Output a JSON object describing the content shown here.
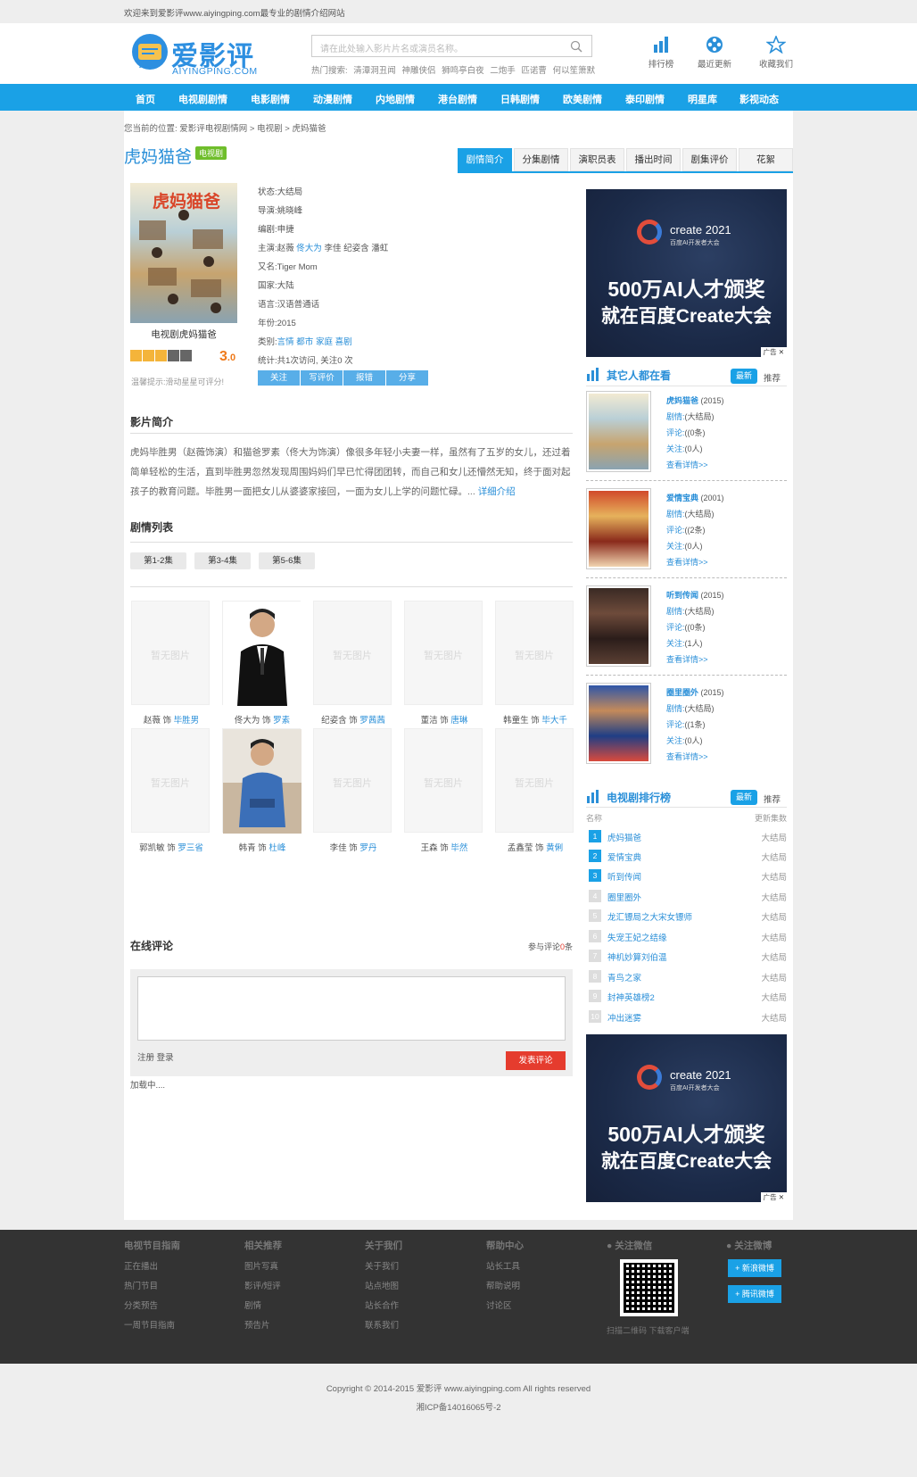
{
  "topbar": {
    "welcome": "欢迎来到爱影评www.aiyingping.com最专业的剧情介绍网站"
  },
  "logo": {
    "name": "爱影评",
    "domain": "AIYINGPING.COM"
  },
  "search": {
    "placeholder": "请在此处输入影片片名或演员名称。",
    "hot_label": "热门搜索:",
    "hot_items": [
      "清潭洞丑闻",
      "神雕侠侣",
      "狮鸣亭白夜",
      "二炮手",
      "匹诺曹",
      "何以笙箫默"
    ]
  },
  "header_links": [
    {
      "label": "排行榜",
      "icon": "chart-icon"
    },
    {
      "label": "最近更新",
      "icon": "film-reel-icon"
    },
    {
      "label": "收藏我们",
      "icon": "star-icon"
    }
  ],
  "nav": [
    "首页",
    "电视剧剧情",
    "电影剧情",
    "动漫剧情",
    "内地剧情",
    "港台剧情",
    "日韩剧情",
    "欧美剧情",
    "泰印剧情",
    "明星库",
    "影视动态"
  ],
  "breadcrumb": {
    "prefix": "您当前的位置:",
    "items": [
      "爱影评电视剧情网",
      "电视剧",
      "虎妈猫爸"
    ]
  },
  "title": "虎妈猫爸",
  "tag": "电视剧",
  "tabs": [
    "剧情简介",
    "分集剧情",
    "演职员表",
    "播出时间",
    "剧集评价",
    "花絮"
  ],
  "poster": {
    "title_on_image": "虎妈猫爸",
    "caption": "电视剧虎妈猫爸"
  },
  "rating": {
    "score_int": "3",
    "score_dec": ".0",
    "stars_on": 3,
    "stars_total": 5,
    "tip": "温馨提示:滑动星星可评分!"
  },
  "info": {
    "status": {
      "label": "状态:",
      "value": "大结局"
    },
    "director": {
      "label": "导演:",
      "value": "姚晓峰"
    },
    "writer": {
      "label": "编剧:",
      "value": "申捷"
    },
    "cast": {
      "label": "主演:",
      "values": [
        "赵薇",
        "佟大为",
        "李佳",
        "纪姿含",
        "潘虹"
      ]
    },
    "alias": {
      "label": "又名:",
      "value": "Tiger Mom"
    },
    "country": {
      "label": "国家:",
      "value": "大陆"
    },
    "language": {
      "label": "语言:",
      "value": "汉语普通话"
    },
    "year": {
      "label": "年份:",
      "value": "2015"
    },
    "genre": {
      "label": "类别:",
      "values": [
        "言情",
        "都市",
        "家庭",
        "喜剧"
      ]
    },
    "stats": {
      "label": "统计:",
      "value": "共1次访问, 关注0 次"
    }
  },
  "actions": [
    "关注",
    "写评价",
    "报错",
    "分享"
  ],
  "intro": {
    "heading": "影片简介",
    "text": "虎妈毕胜男（赵薇饰演）和猫爸罗素（佟大为饰演）像很多年轻小夫妻一样，虽然有了五岁的女儿，还过着简单轻松的生活，直到毕胜男忽然发现周围妈妈们早已忙得团团转，而自己和女儿还懵然无知，终于面对起孩子的教育问题。毕胜男一面把女儿从婆婆家接回，一面为女儿上学的问题忙碌。...",
    "more": "详细介绍"
  },
  "episodes": {
    "heading": "剧情列表",
    "items": [
      "第1-2集",
      "第3-4集",
      "第5-6集"
    ]
  },
  "cast_cards": [
    {
      "actor": "赵薇",
      "sep": "饰",
      "role": "毕胜男",
      "has_photo": false
    },
    {
      "actor": "佟大为",
      "sep": "饰",
      "role": "罗素",
      "has_photo": true
    },
    {
      "actor": "纪姿含",
      "sep": "饰",
      "role": "罗茜茜",
      "has_photo": false
    },
    {
      "actor": "董洁",
      "sep": "饰",
      "role": "唐琳",
      "has_photo": false
    },
    {
      "actor": "韩童生",
      "sep": "饰",
      "role": "毕大千",
      "has_photo": false
    },
    {
      "actor": "郭凯敏",
      "sep": "饰",
      "role": "罗三省",
      "has_photo": false
    },
    {
      "actor": "韩青",
      "sep": "饰",
      "role": "杜峰",
      "has_photo": true
    },
    {
      "actor": "李佳",
      "sep": "饰",
      "role": "罗丹",
      "has_photo": false
    },
    {
      "actor": "王森",
      "sep": "饰",
      "role": "毕然",
      "has_photo": false
    },
    {
      "actor": "孟鑫莹",
      "sep": "饰",
      "role": "黄俐",
      "has_photo": false
    }
  ],
  "no_image_text": "暂无图片",
  "watermark": "aiyingping.com",
  "comments": {
    "heading": "在线评论",
    "count_prefix": "参与评论",
    "count": "0",
    "count_suffix": "条",
    "register": "注册",
    "login": "登录",
    "submit": "发表评论",
    "loading": "加载中...."
  },
  "ad": {
    "brand": "create 2021",
    "sub": "百度AI开发者大会",
    "line1": "500万AI人才颁奖",
    "line2": "就在百度Create大会",
    "tag": "广告"
  },
  "others": {
    "heading": "其它人都在看",
    "tab_new": "最新",
    "tab_rec": "推荐",
    "items": [
      {
        "name": "虎妈猫爸",
        "year": "(2015)",
        "plot": "剧情:",
        "plot_v": "(大结局)",
        "review": "评论:",
        "review_v": "((0条)",
        "follow": "关注:",
        "follow_v": "(0人)",
        "more": "查看详情>>"
      },
      {
        "name": "爱情宝典",
        "year": "(2001)",
        "plot": "剧情:",
        "plot_v": "(大结局)",
        "review": "评论:",
        "review_v": "((2条)",
        "follow": "关注:",
        "follow_v": "(0人)",
        "more": "查看详情>>"
      },
      {
        "name": "听到传闻",
        "year": "(2015)",
        "plot": "剧情:",
        "plot_v": "(大结局)",
        "review": "评论:",
        "review_v": "((0条)",
        "follow": "关注:",
        "follow_v": "(1人)",
        "more": "查看详情>>"
      },
      {
        "name": "圈里圈外",
        "year": "(2015)",
        "plot": "剧情:",
        "plot_v": "(大结局)",
        "review": "评论:",
        "review_v": "((1条)",
        "follow": "关注:",
        "follow_v": "(0人)",
        "more": "查看详情>>"
      }
    ]
  },
  "ranking": {
    "heading": "电视剧排行榜",
    "tab_new": "最新",
    "tab_rec": "推荐",
    "col_name": "名称",
    "col_update": "更新集数",
    "items": [
      {
        "n": "1",
        "name": "虎妈猫爸",
        "status": "大结局"
      },
      {
        "n": "2",
        "name": "爱情宝典",
        "status": "大结局"
      },
      {
        "n": "3",
        "name": "听到传闻",
        "status": "大结局"
      },
      {
        "n": "4",
        "name": "圈里圈外",
        "status": "大结局"
      },
      {
        "n": "5",
        "name": "龙汇镖局之大宋女镖师",
        "status": "大结局"
      },
      {
        "n": "6",
        "name": "失宠王妃之结缘",
        "status": "大结局"
      },
      {
        "n": "7",
        "name": "神机妙算刘伯温",
        "status": "大结局"
      },
      {
        "n": "8",
        "name": "青鸟之家",
        "status": "大结局"
      },
      {
        "n": "9",
        "name": "封神英雄榜2",
        "status": "大结局"
      },
      {
        "n": "10",
        "name": "冲出迷雾",
        "status": "大结局"
      }
    ]
  },
  "footer": {
    "cols": [
      {
        "h": "电视节目指南",
        "items": [
          "正在播出",
          "热门节目",
          "分类预告",
          "一周节目指南"
        ]
      },
      {
        "h": "相关推荐",
        "items": [
          "图片写真",
          "影评/短评",
          "剧情",
          "预告片"
        ]
      },
      {
        "h": "关于我们",
        "items": [
          "关于我们",
          "站点地图",
          "站长合作",
          "联系我们"
        ]
      },
      {
        "h": "帮助中心",
        "items": [
          "站长工具",
          "帮助说明",
          "讨论区"
        ]
      }
    ],
    "wechat": "关注微信",
    "wechat_cap": "扫描二维码 下载客户端",
    "weibo": "关注微博",
    "weibo_sina": "新浪微博",
    "weibo_qq": "腾讯微博",
    "copyright": "Copyright © 2014-2015 爱影评 www.aiyingping.com All rights reserved",
    "icp": "湘ICP备14016065号-2"
  },
  "colors": {
    "brand": "#1aa1e6",
    "link": "#2a8fd8",
    "score": "#ef7a1a",
    "submit": "#e53c2e",
    "tag": "#6fbe2b"
  }
}
